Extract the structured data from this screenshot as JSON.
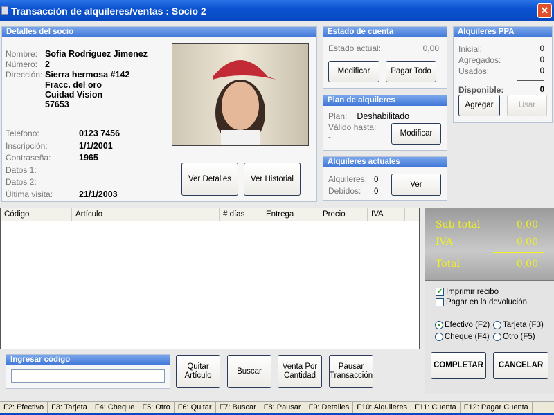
{
  "window": {
    "title": "Transacción de alquileres/ventas : Socio 2",
    "close": "✕"
  },
  "socio": {
    "header": "Detalles del socio",
    "fields": [
      {
        "label": "Nombre:",
        "value": "Sofia Rodriguez Jimenez"
      },
      {
        "label": "Número:",
        "value": "2"
      },
      {
        "label": "Dirección:",
        "value": "Sierra hermosa #142"
      }
    ],
    "address_lines": [
      "Fracc. del oro",
      "Cuidad Vision",
      "57653"
    ],
    "fields2": [
      {
        "label": "Teléfono:",
        "value": "0123 7456"
      },
      {
        "label": "Inscripción:",
        "value": "1/1/2001"
      },
      {
        "label": "Contraseña:",
        "value": "1965"
      },
      {
        "label": "Datos 1:",
        "value": ""
      },
      {
        "label": "Datos 2:",
        "value": ""
      },
      {
        "label": "Última visita:",
        "value": "21/1/2003"
      }
    ],
    "btn_detalles": "Ver Detalles",
    "btn_historial": "Ver Historial"
  },
  "estado": {
    "header": "Estado de cuenta",
    "label": "Estado actual:",
    "value": "0,00",
    "btn_modificar": "Modificar",
    "btn_pagar": "Pagar Todo"
  },
  "plan": {
    "header": "Plan de alquileres",
    "plan_label": "Plan:",
    "plan_value": "Deshabilitado",
    "valido_label": "Válido hasta:",
    "valido_value": "-",
    "btn_modificar": "Modificar"
  },
  "actuales": {
    "header": "Alquileres actuales",
    "alq_label": "Alquileres:",
    "alq_value": "0",
    "deb_label": "Debidos:",
    "deb_value": "0",
    "btn_ver": "Ver"
  },
  "ppa": {
    "header": "Alquileres PPA",
    "inicial_label": "Inicial:",
    "inicial": "0",
    "agregados_label": "Agregados:",
    "agregados": "0",
    "usados_label": "Usados:",
    "usados": "0",
    "disponible_label": "Disponible:",
    "disponible": "0",
    "btn_agregar": "Agregar",
    "btn_usar": "Usar"
  },
  "table": {
    "columns": [
      "Código",
      "Artículo",
      "# días",
      "Entrega",
      "Precio",
      "IVA"
    ],
    "rows": []
  },
  "codigo": {
    "header": "Ingresar código",
    "value": "",
    "btn_quitar": "Quitar Artículo",
    "btn_buscar": "Buscar",
    "btn_venta": "Venta Por Cantidad",
    "btn_pausar": "Pausar Transacción"
  },
  "totals": {
    "subtotal_label": "Sub total",
    "subtotal": "0,00",
    "iva_label": "IVA",
    "iva": "0,00",
    "total_label": "Total",
    "total": "0,00",
    "text_color": "#f0f020"
  },
  "options": {
    "imprimir": "Imprimir recibo",
    "imprimir_checked": true,
    "pagar_dev": "Pagar en la devolución",
    "pagar_dev_checked": false,
    "payment": [
      {
        "label": "Efectivo (F2)",
        "selected": true
      },
      {
        "label": "Tarjeta (F3)",
        "selected": false
      },
      {
        "label": "Cheque (F4)",
        "selected": false
      },
      {
        "label": "Otro (F5)",
        "selected": false
      }
    ],
    "btn_completar": "COMPLETAR",
    "btn_cancelar": "CANCELAR"
  },
  "statusbar": [
    "F2: Efectivo",
    "F3: Tarjeta",
    "F4: Cheque",
    "F5: Otro",
    "F6: Quitar",
    "F7: Buscar",
    "F8: Pausar",
    "F9: Detalles",
    "F10: Alquileres",
    "F11: Cuenta",
    "F12: Pagar Cuenta"
  ]
}
